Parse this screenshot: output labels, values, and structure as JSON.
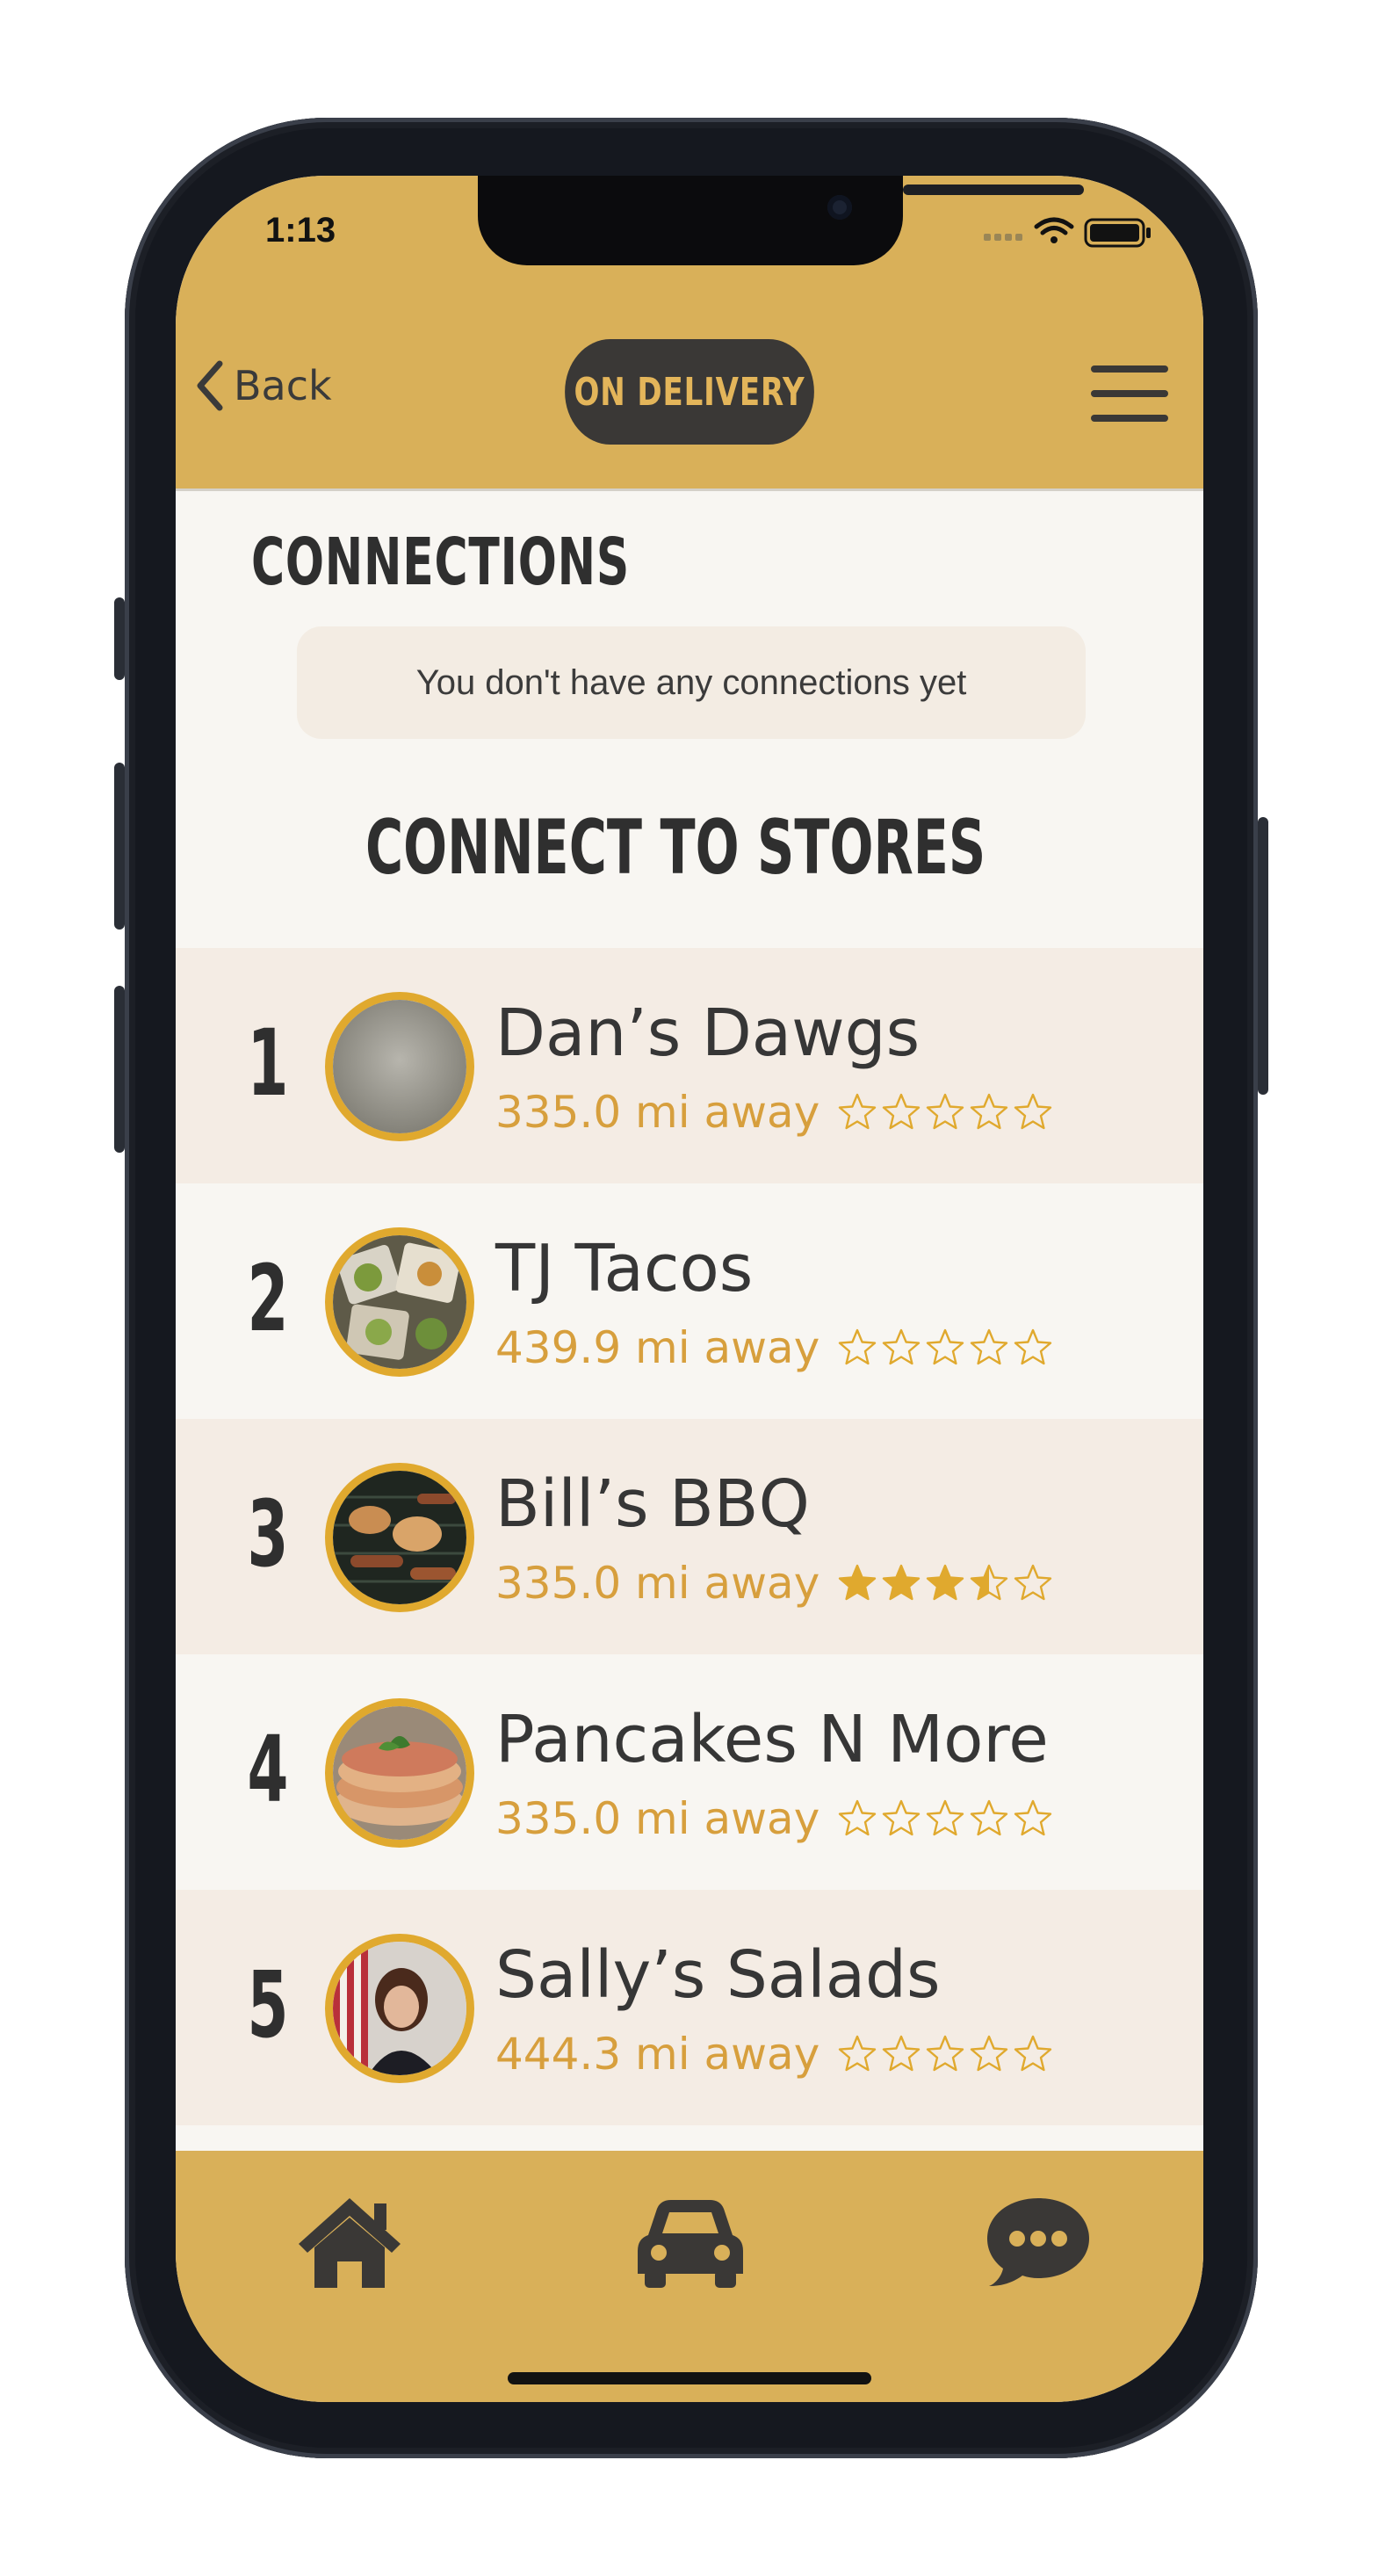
{
  "status_bar": {
    "time": "1:13"
  },
  "header": {
    "back_label": "Back",
    "mode_pill": "ON DELIVERY"
  },
  "connections": {
    "title": "CONNECTIONS",
    "empty_message": "You don't have any connections yet"
  },
  "connect_section": {
    "title": "CONNECT TO STORES"
  },
  "stores": [
    {
      "rank": "1",
      "name": "Dan’s Dawgs",
      "distance": "335.0 mi away",
      "rating": 0
    },
    {
      "rank": "2",
      "name": "TJ Tacos",
      "distance": "439.9 mi away",
      "rating": 0
    },
    {
      "rank": "3",
      "name": "Bill’s BBQ",
      "distance": "335.0 mi away",
      "rating": 3.5
    },
    {
      "rank": "4",
      "name": "Pancakes N More",
      "distance": "335.0 mi away",
      "rating": 0
    },
    {
      "rank": "5",
      "name": "Sally’s Salads",
      "distance": "444.3 mi away",
      "rating": 0
    }
  ],
  "bottom_nav": {
    "items": [
      "home-icon",
      "car-icon",
      "chat-icon"
    ]
  },
  "colors": {
    "accent_gold": "#d9b059",
    "dark": "#3a3836",
    "distance_text": "#d79f3d",
    "avatar_ring": "#e0a92e"
  }
}
